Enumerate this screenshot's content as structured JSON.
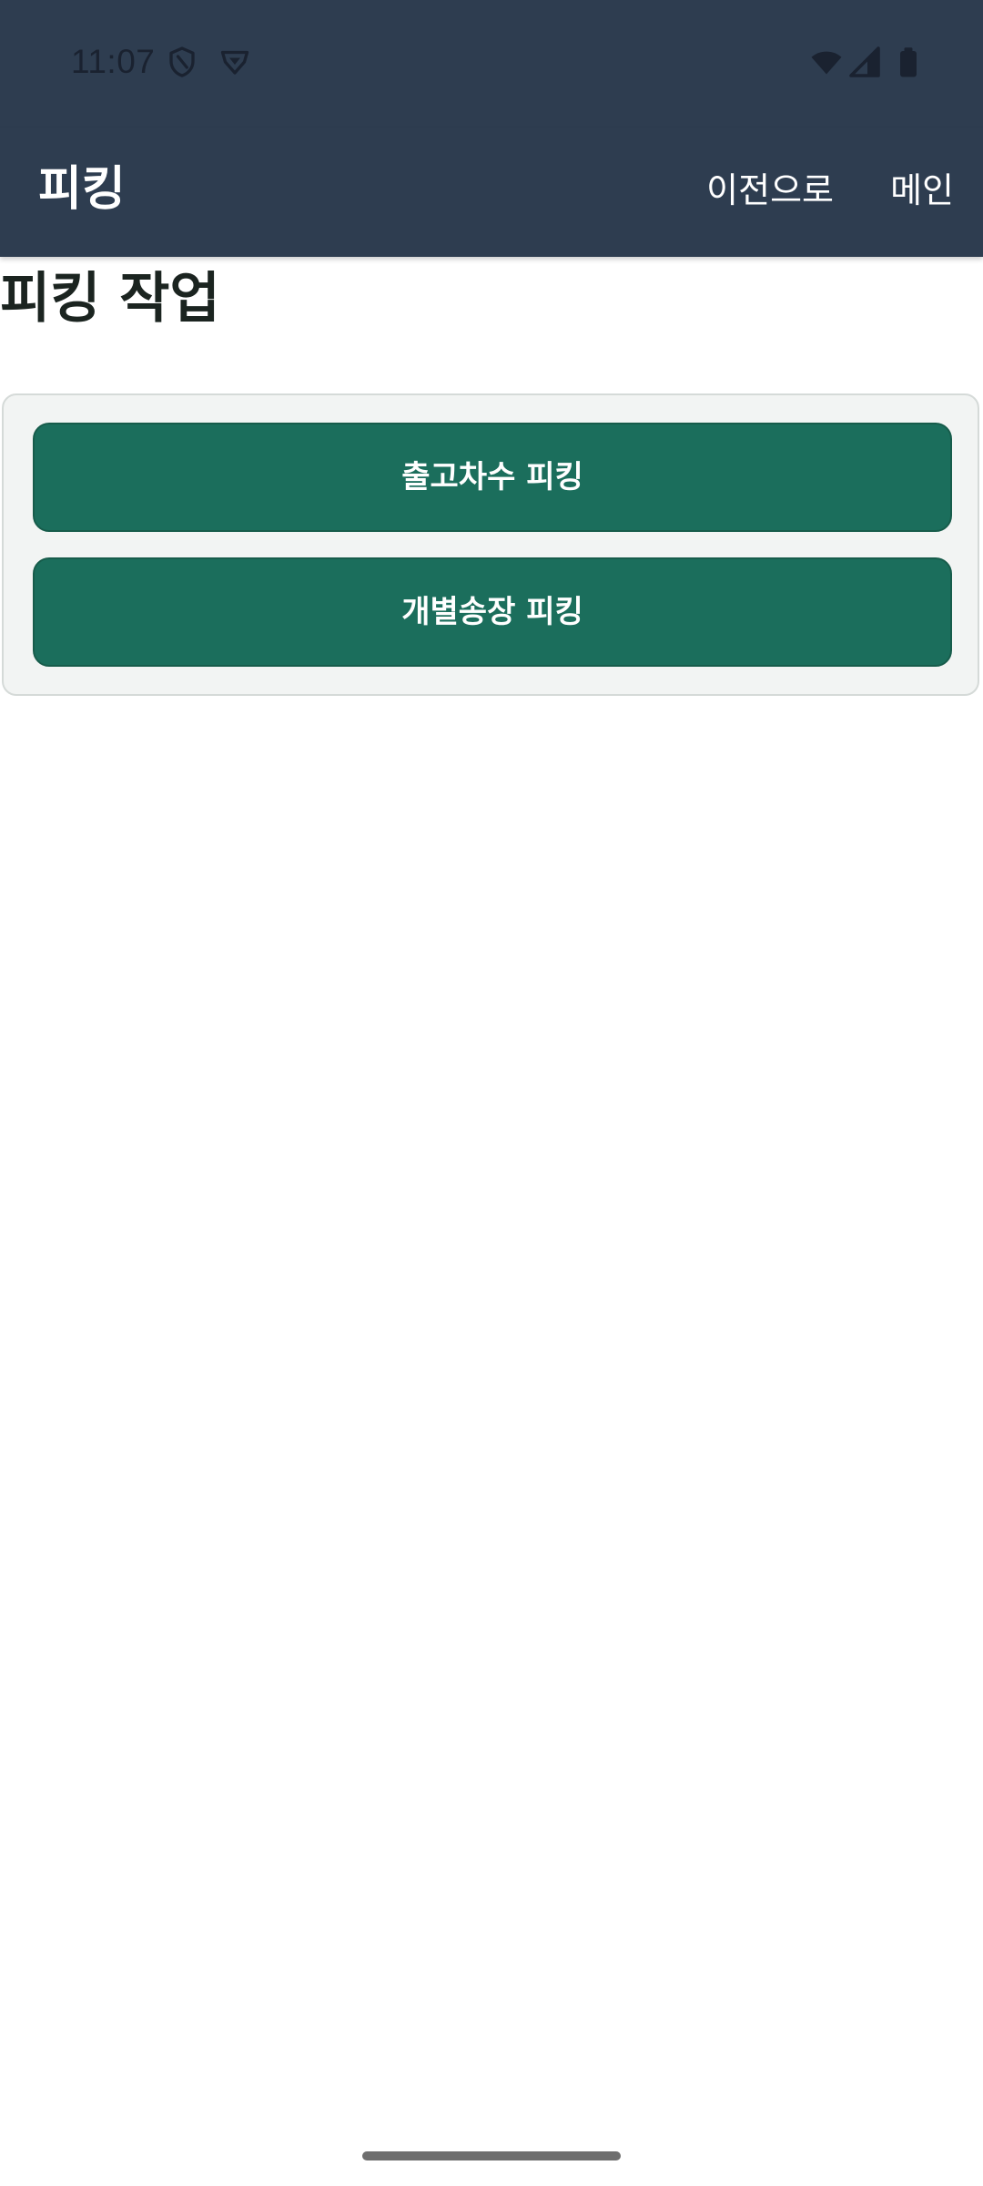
{
  "status_bar": {
    "time": "11:07",
    "left_icons": [
      "shield-icon",
      "vpn-icon"
    ],
    "right_icons": [
      "wifi-icon",
      "cellular-signal-icon",
      "battery-icon"
    ]
  },
  "app_bar": {
    "title": "피킹",
    "back_label": "이전으로",
    "main_label": "메인",
    "background": "#2e3d50"
  },
  "page": {
    "heading": "피킹 작업"
  },
  "actions": {
    "wave_picking_label": "출고차수 피킹",
    "invoice_picking_label": "개별송장 피킹",
    "button_color": "#1b6e5c"
  }
}
